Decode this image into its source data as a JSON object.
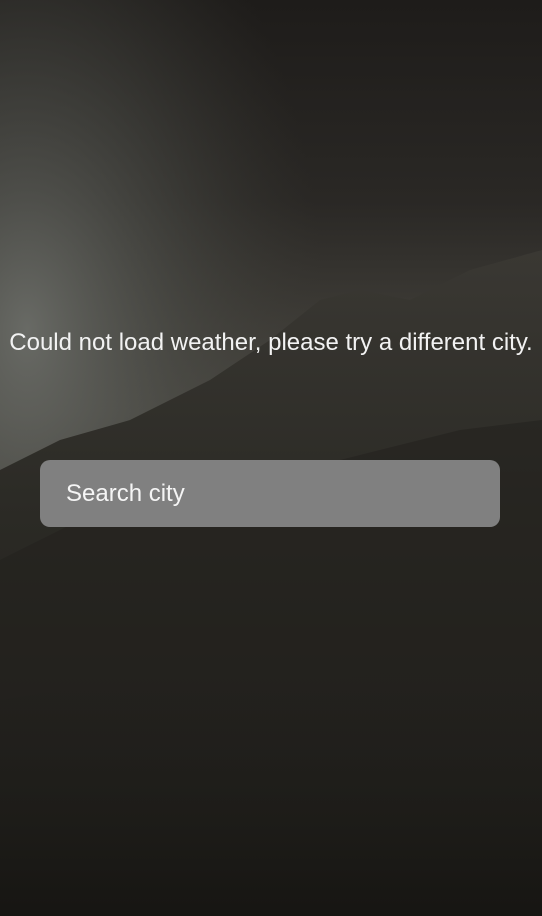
{
  "error": {
    "message": "Could not load weather, please try a different city."
  },
  "search": {
    "placeholder": "Search city",
    "value": ""
  },
  "background": {
    "description_icon": "mountain-fog-image"
  },
  "colors": {
    "input_background": "#808080",
    "text": "#f2f2f2"
  }
}
